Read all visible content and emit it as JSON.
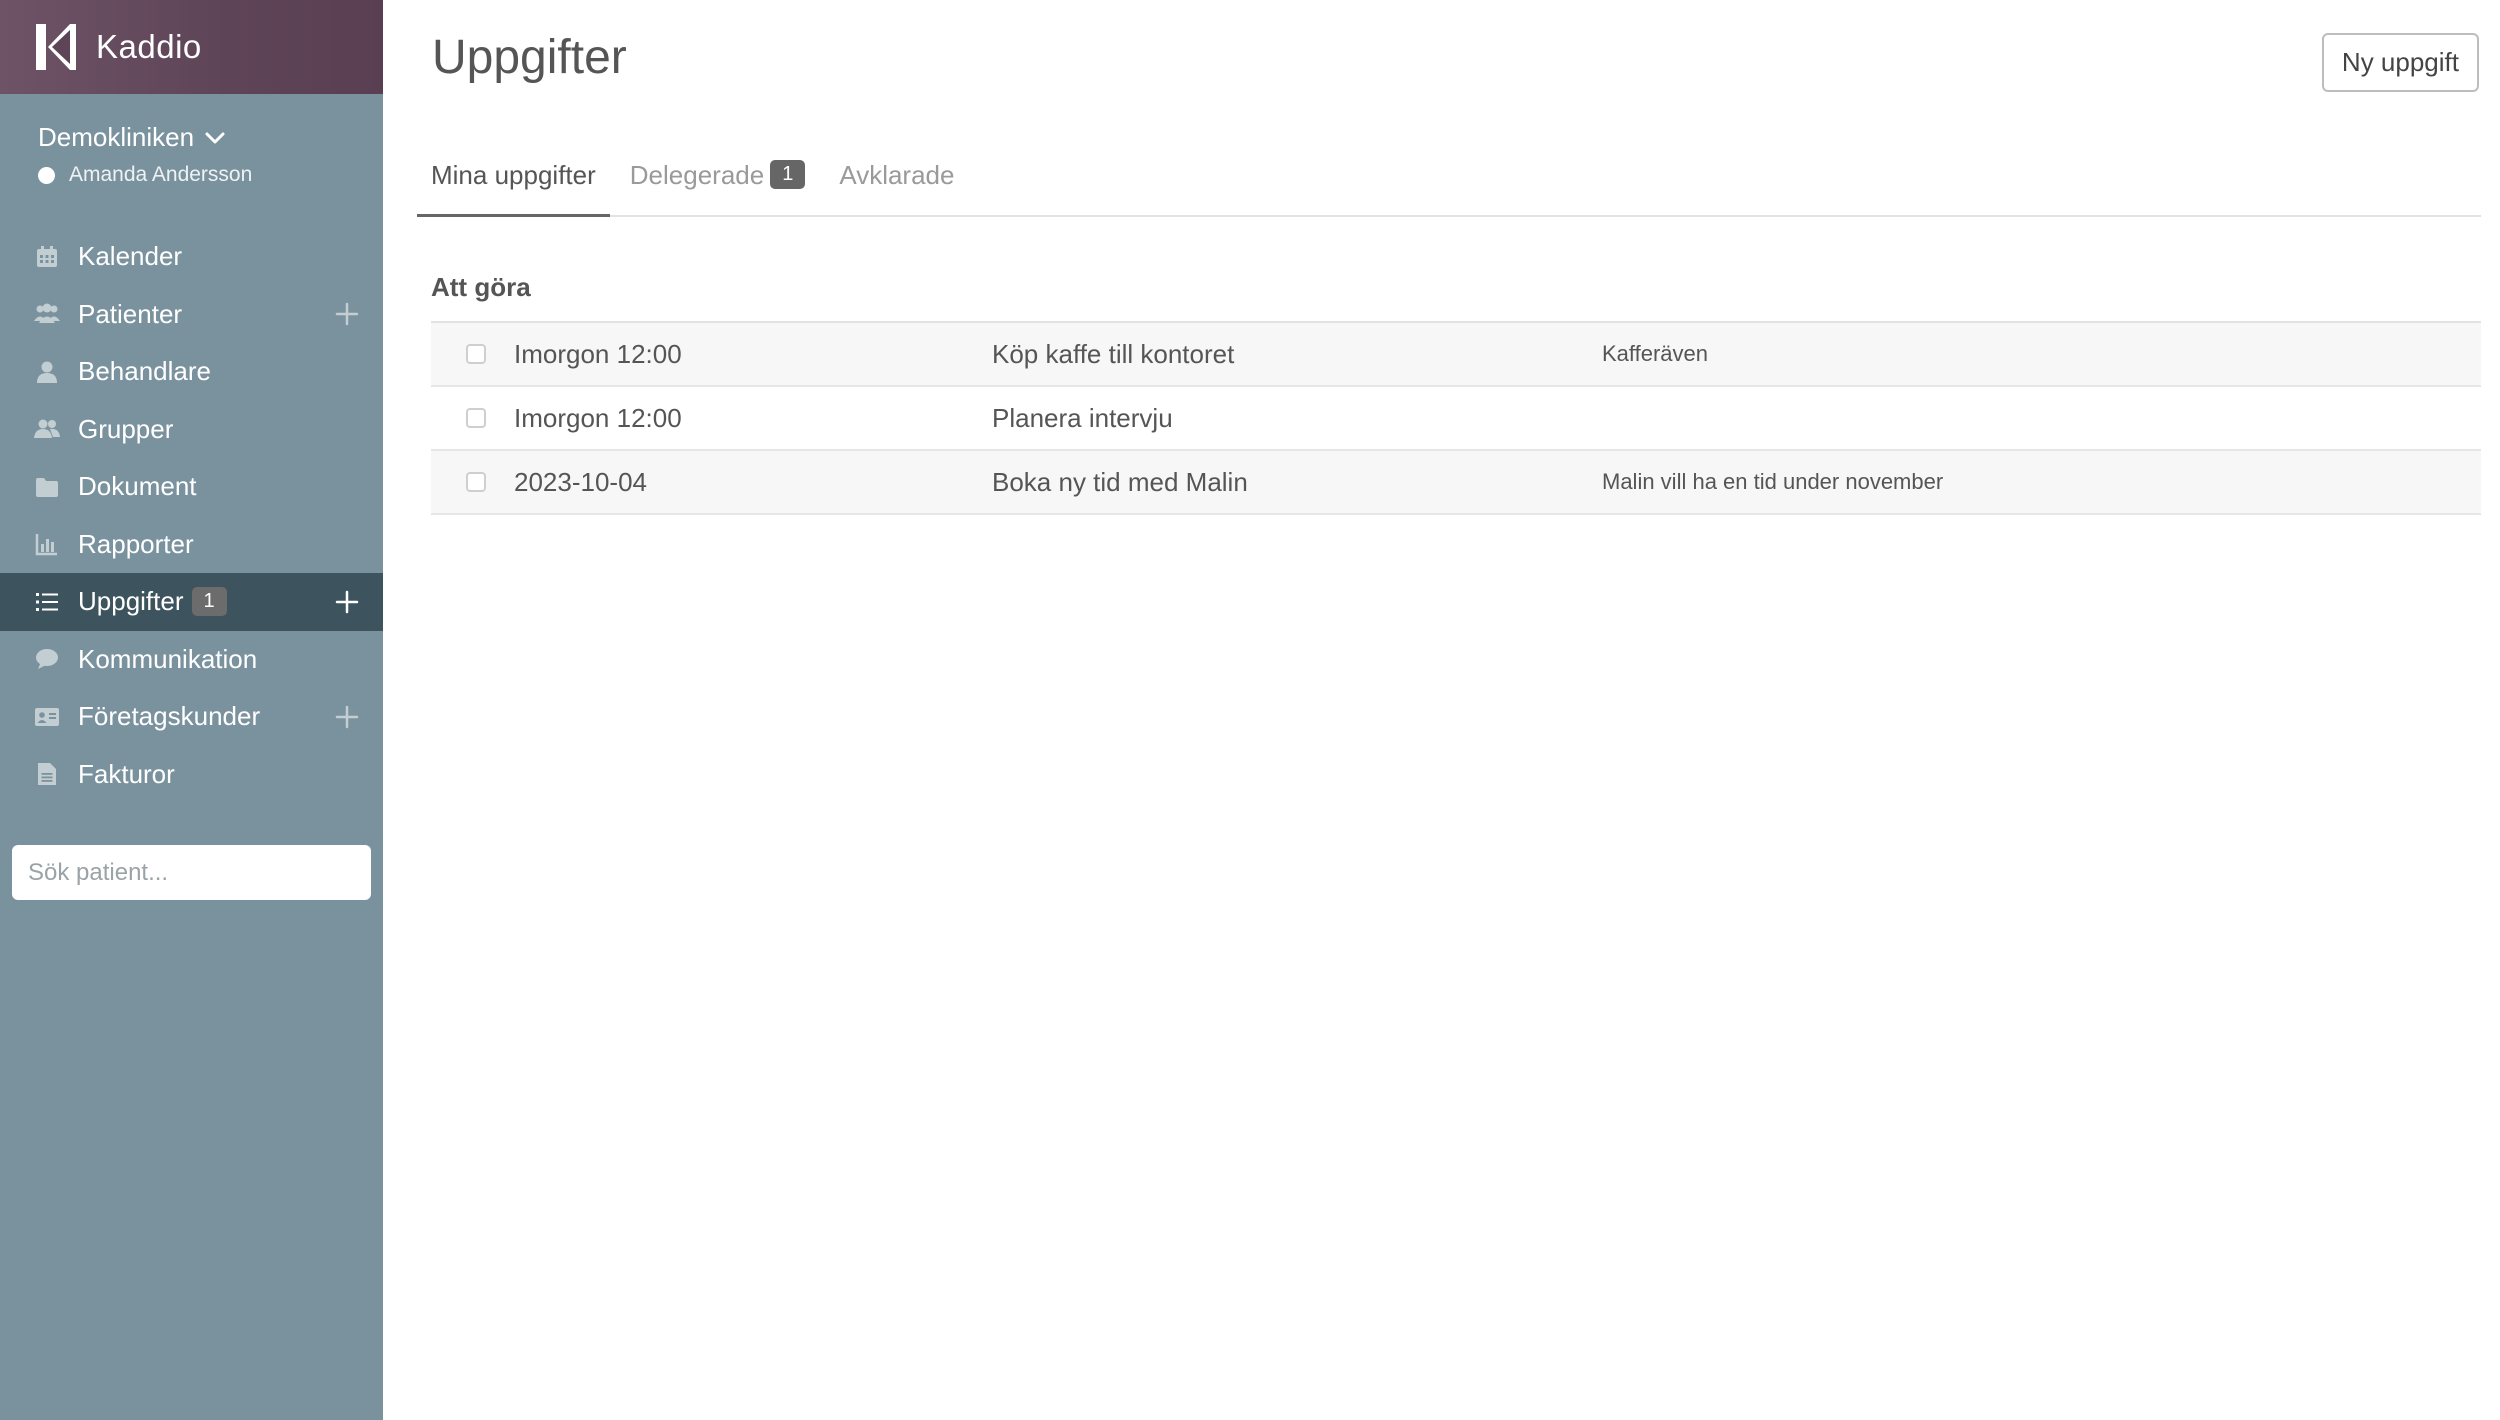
{
  "sidebar": {
    "brand": "Kaddio",
    "clinic": "Demokliniken",
    "user": "Amanda Andersson",
    "items": [
      {
        "label": "Kalender",
        "icon": "calendar-icon"
      },
      {
        "label": "Patienter",
        "icon": "users-icon",
        "plus": true
      },
      {
        "label": "Behandlare",
        "icon": "user-icon"
      },
      {
        "label": "Grupper",
        "icon": "group-icon"
      },
      {
        "label": "Dokument",
        "icon": "folder-icon"
      },
      {
        "label": "Rapporter",
        "icon": "chart-icon"
      },
      {
        "label": "Uppgifter",
        "icon": "list-icon",
        "badge": "1",
        "plus": true,
        "active": true
      },
      {
        "label": "Kommunikation",
        "icon": "chat-icon"
      },
      {
        "label": "Företagskunder",
        "icon": "id-card-icon",
        "plus": true
      },
      {
        "label": "Fakturor",
        "icon": "document-icon"
      }
    ],
    "search_placeholder": "Sök patient..."
  },
  "main": {
    "title": "Uppgifter",
    "new_button": "Ny uppgift",
    "tabs": [
      {
        "label": "Mina uppgifter",
        "active": true
      },
      {
        "label": "Delegerade",
        "badge": "1"
      },
      {
        "label": "Avklarade"
      }
    ],
    "section_title": "Att göra",
    "tasks": [
      {
        "date": "Imorgon 12:00",
        "title": "Köp kaffe till kontoret",
        "note": "Kafferäven"
      },
      {
        "date": "Imorgon 12:00",
        "title": "Planera intervju",
        "note": ""
      },
      {
        "date": "2023-10-04",
        "title": "Boka ny tid med Malin",
        "note": "Malin vill ha en tid under november"
      }
    ]
  }
}
